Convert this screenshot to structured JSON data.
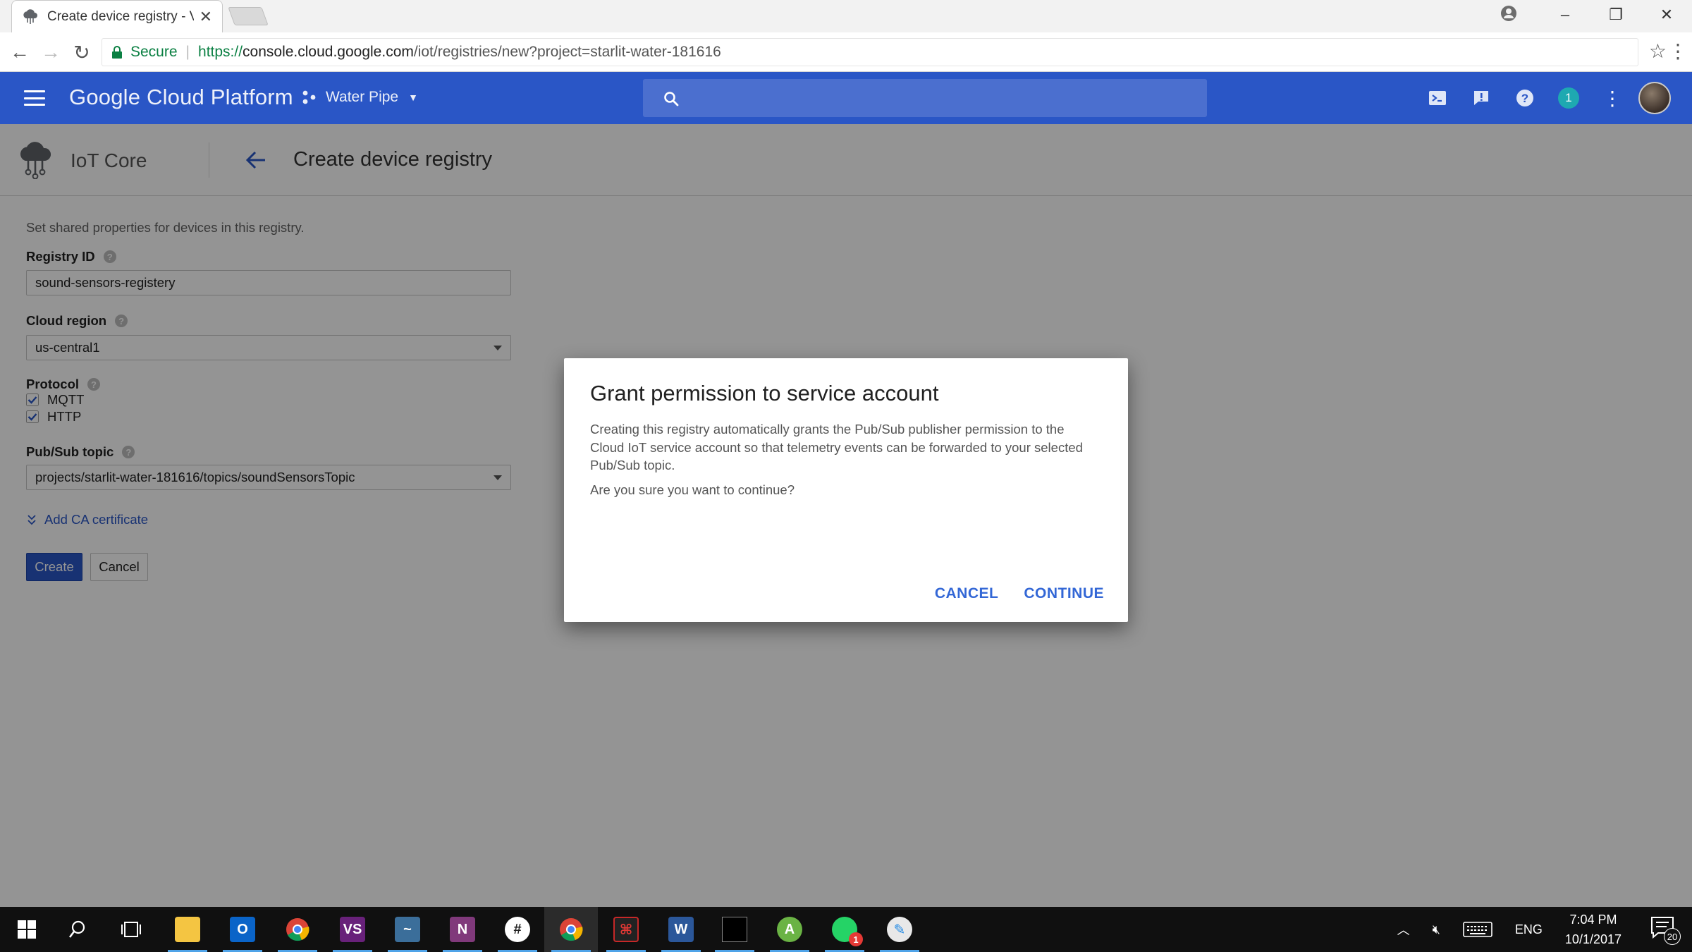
{
  "browser": {
    "tab_title": "Create device registry - V",
    "secure_label": "Secure",
    "url_scheme": "https://",
    "url_host": "console.cloud.google.com",
    "url_path": "/iot/registries/new?project=starlit-water-181616"
  },
  "header": {
    "title": "Google Cloud Platform",
    "project": "Water Pipe",
    "notification_count": "1"
  },
  "subheader": {
    "product": "IoT Core",
    "page_title": "Create device registry"
  },
  "form": {
    "intro": "Set shared properties for devices in this registry.",
    "registry_id_label": "Registry ID",
    "registry_id_value": "sound-sensors-registery",
    "region_label": "Cloud region",
    "region_value": "us-central1",
    "protocol_label": "Protocol",
    "protocol_options": [
      {
        "label": "MQTT",
        "checked": true
      },
      {
        "label": "HTTP",
        "checked": true
      }
    ],
    "topic_label": "Pub/Sub topic",
    "topic_value": "projects/starlit-water-181616/topics/soundSensorsTopic",
    "add_ca_label": "Add CA certificate",
    "create_label": "Create",
    "cancel_label": "Cancel"
  },
  "dialog": {
    "title": "Grant permission to service account",
    "body": "Creating this registry automatically grants the Pub/Sub publisher permission to the Cloud IoT service account so that telemetry events can be forwarded to your selected Pub/Sub topic.",
    "question": "Are you sure you want to continue?",
    "cancel_label": "CANCEL",
    "continue_label": "CONTINUE"
  },
  "taskbar": {
    "language": "ENG",
    "time": "7:04 PM",
    "date": "10/1/2017",
    "notification_count": "20",
    "whatsapp_badge": "1"
  },
  "colors": {
    "gcp_blue": "#2a56c6",
    "dialog_button": "#3367d6",
    "secure_green": "#0b8043"
  }
}
